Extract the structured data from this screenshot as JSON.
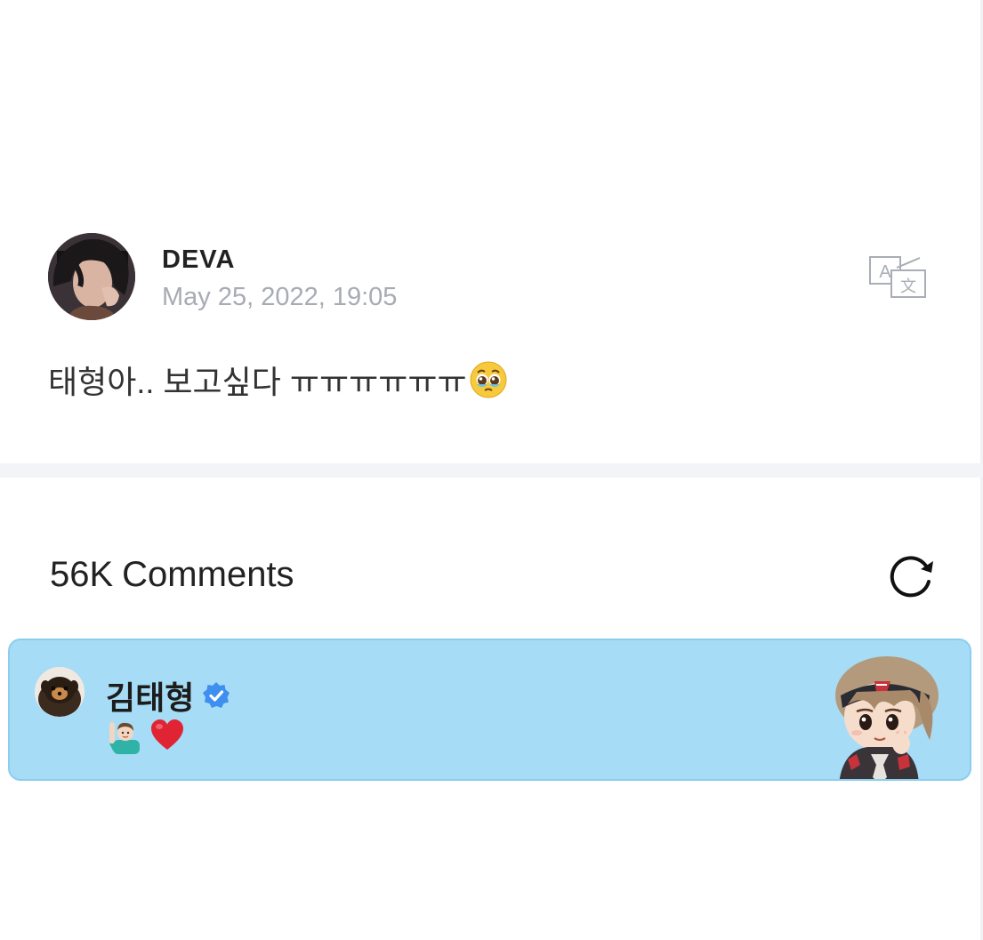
{
  "post": {
    "author_name": "DEVA",
    "date": "May 25, 2022, 19:05",
    "text": "태형아.. 보고싶다 ㅠㅠㅠㅠㅠㅠ",
    "emoji": "pleading-face",
    "translate_icon": "translate-icon"
  },
  "comments": {
    "count": "56K",
    "label": "Comments",
    "refresh_icon": "refresh-icon"
  },
  "highlighted_comment": {
    "author_name": "김태형",
    "verified": true,
    "badge_color": "#3d8ff0",
    "card_color": "#a6dcf5",
    "body_emojis": [
      "person-raising-hand",
      "red-heart"
    ],
    "sticker": "character-sticker"
  }
}
